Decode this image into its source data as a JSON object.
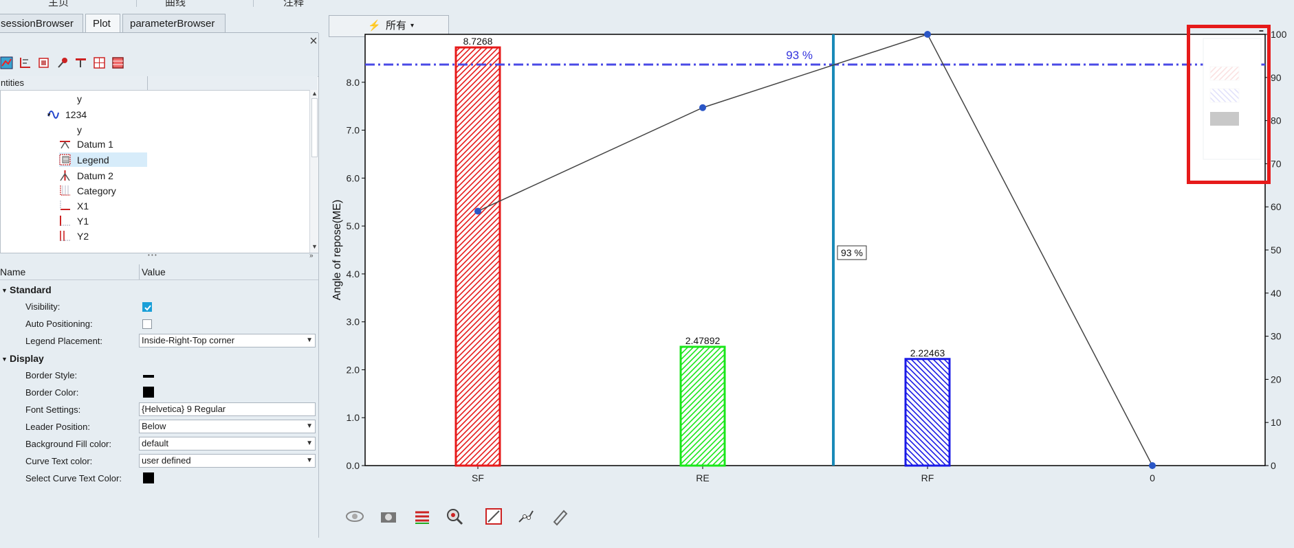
{
  "top_menu": [
    "主页",
    "曲线",
    "注释"
  ],
  "tabs": [
    {
      "label": "sessionBrowser",
      "active": false
    },
    {
      "label": "Plot",
      "active": true
    },
    {
      "label": "parameterBrowser",
      "active": false
    }
  ],
  "close_glyph": "×",
  "tree": {
    "header": "ntities",
    "items": [
      {
        "label": "y",
        "icon": "none"
      },
      {
        "label": "1234",
        "icon": "curve-icon"
      },
      {
        "label": "y",
        "icon": "none"
      },
      {
        "label": "Datum 1",
        "icon": "datum-horizontal-icon"
      },
      {
        "label": "Legend",
        "icon": "legend-icon"
      },
      {
        "label": "Datum 2",
        "icon": "datum-vertical-icon"
      },
      {
        "label": "Category",
        "icon": "category-icon"
      },
      {
        "label": "X1",
        "icon": "x-axis-icon"
      },
      {
        "label": "Y1",
        "icon": "y-axis-icon"
      },
      {
        "label": "Y2",
        "icon": "y2-axis-icon"
      }
    ],
    "splitter": "• • •"
  },
  "props": {
    "col_name": "Name",
    "col_value": "Value",
    "sections": [
      {
        "title": "Standard"
      },
      {
        "title": "Display"
      }
    ],
    "visibility": "Visibility:",
    "auto_positioning": "Auto Positioning:",
    "legend_placement": "Legend Placement:",
    "legend_placement_value": "Inside-Right-Top corner",
    "border_style": "Border Style:",
    "border_color": "Border Color:",
    "font_settings": "Font Settings:",
    "font_settings_value": "{Helvetica} 9 Regular",
    "leader_position": "Leader Position:",
    "leader_position_value": "Below",
    "bg_fill": "Background Fill color:",
    "bg_fill_value": "default",
    "curve_text": "Curve Text color:",
    "curve_text_value": "user defined",
    "select_curve_text": "Select Curve Text Color:",
    "visibility_checked": true,
    "auto_positioning_checked": false
  },
  "filter": {
    "label": "所有"
  },
  "colors": {
    "accent": "#1a9fd8",
    "highlight_box": "#e61a1a",
    "datum_h": "#4a4ae6",
    "datum_v": "#1a8ab8"
  },
  "chart_data": {
    "type": "bar",
    "categories": [
      "SF",
      "RE",
      "RF",
      "0"
    ],
    "series": [
      {
        "values": [
          8.7268,
          2.47892,
          2.22463
        ],
        "colors": [
          "#e61a1a",
          "#1ae61a",
          "#1a1ae6"
        ],
        "labels": [
          "8.7268",
          "2.47892",
          "2.22463"
        ]
      },
      {
        "type": "line",
        "values": [
          59,
          83,
          100,
          0
        ],
        "axis": "y2"
      }
    ],
    "ylabel": "Angle of repose(ME)",
    "ylim": [
      0,
      9
    ],
    "y_ticks": [
      "0.0",
      "1.0",
      "2.0",
      "3.0",
      "4.0",
      "5.0",
      "6.0",
      "7.0",
      "8.0"
    ],
    "y2lim": [
      0,
      100
    ],
    "y2_ticks": [
      "0",
      "10",
      "20",
      "30",
      "40",
      "50",
      "60",
      "70",
      "80",
      "90",
      "100"
    ],
    "datum_h": {
      "value": 93,
      "label": "93 %"
    },
    "datum_v": {
      "label": "93 %"
    }
  }
}
